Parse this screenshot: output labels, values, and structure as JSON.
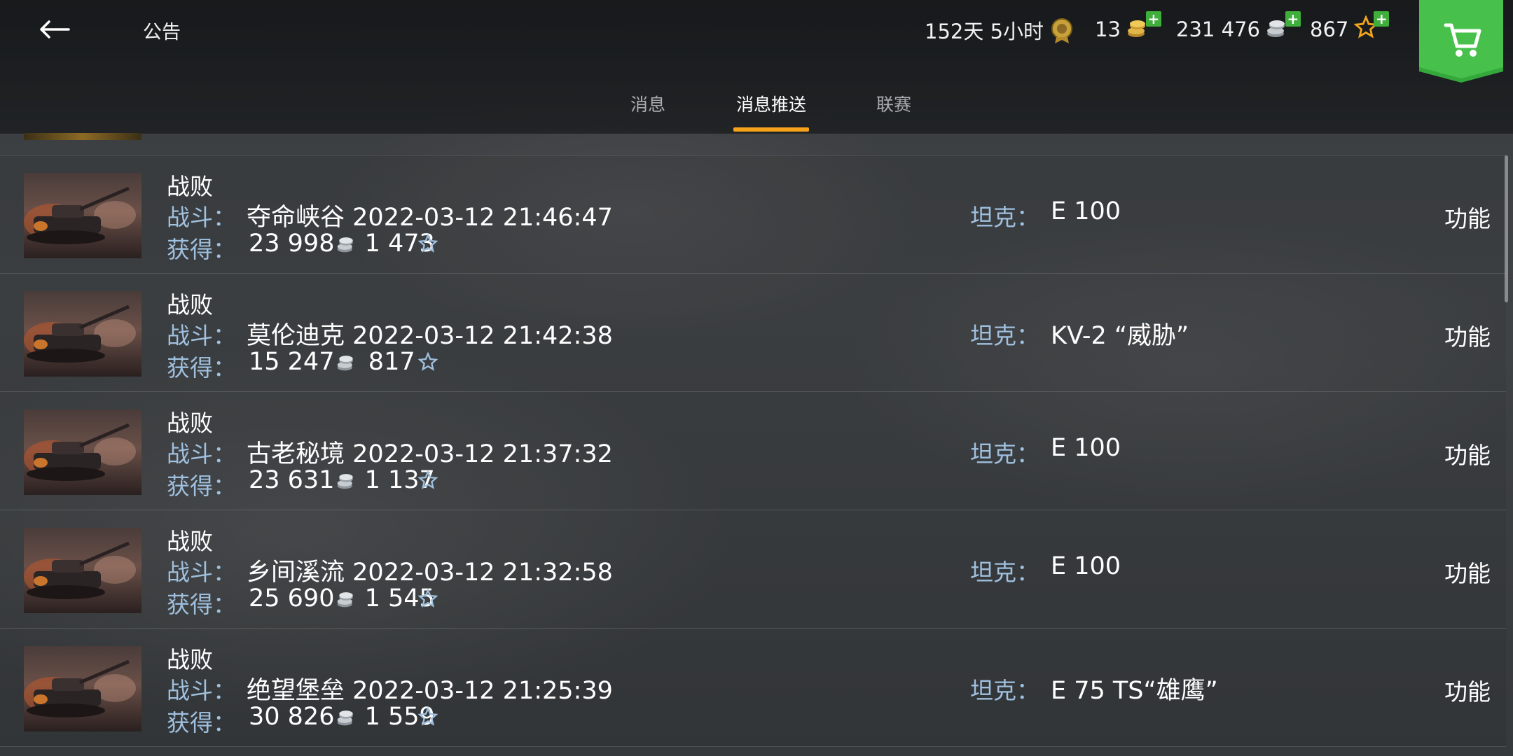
{
  "header": {
    "title": "公告",
    "premium_time": "152天 5小时",
    "gold": "13",
    "silver": "231 476",
    "xp": "867"
  },
  "tabs": [
    {
      "label": "消息",
      "active": false
    },
    {
      "label": "消息推送",
      "active": true
    },
    {
      "label": "联赛",
      "active": false
    }
  ],
  "labels": {
    "battle": "战斗：",
    "earned": "获得：",
    "tank": "坦克：",
    "function": "功能"
  },
  "colors": {
    "accent_tab": "#f7a21b",
    "label_blue": "#9fc0de",
    "shop_green": "#3fae3a"
  },
  "messages": [
    {
      "result": "战败",
      "map": "夺命峡谷",
      "datetime": "2022-03-12 21:46:47",
      "silver": "23 998",
      "xp": "1 473",
      "tank": "E 100"
    },
    {
      "result": "战败",
      "map": "莫伦迪克",
      "datetime": "2022-03-12 21:42:38",
      "silver": "15 247",
      "xp": "817",
      "tank": "KV-2 “威胁”"
    },
    {
      "result": "战败",
      "map": "古老秘境",
      "datetime": "2022-03-12 21:37:32",
      "silver": "23 631",
      "xp": "1 137",
      "tank": "E 100"
    },
    {
      "result": "战败",
      "map": "乡间溪流",
      "datetime": "2022-03-12 21:32:58",
      "silver": "25 690",
      "xp": "1 545",
      "tank": "E 100"
    },
    {
      "result": "战败",
      "map": "绝望堡垒",
      "datetime": "2022-03-12 21:25:39",
      "silver": "30 826",
      "xp": "1 559",
      "tank": "E 75 TS“雄鹰”"
    }
  ]
}
